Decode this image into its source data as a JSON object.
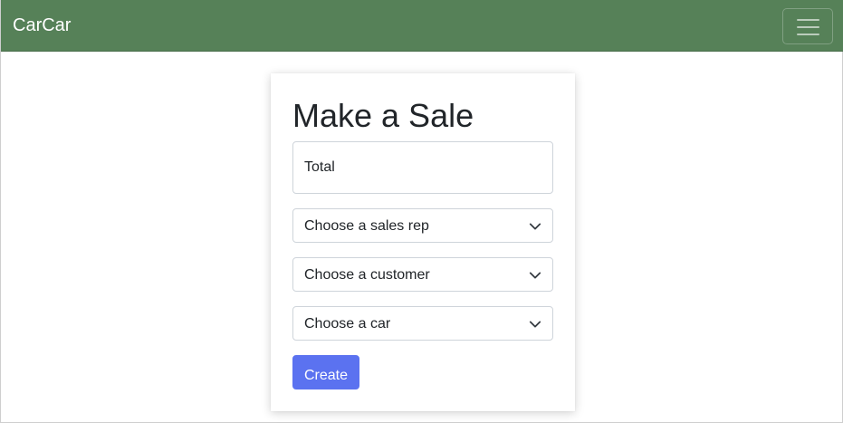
{
  "navbar": {
    "brand": "CarCar",
    "bg_color": "#568158",
    "toggler_icon": "hamburger-menu-icon"
  },
  "form": {
    "title": "Make a Sale",
    "total_placeholder": "Total",
    "total_value": "",
    "sales_rep_select": "Choose a sales rep",
    "customer_select": "Choose a customer",
    "car_select": "Choose a car",
    "submit_label": "Create",
    "submit_color": "#5b72f0",
    "select_icon": "chevron-down-icon"
  }
}
